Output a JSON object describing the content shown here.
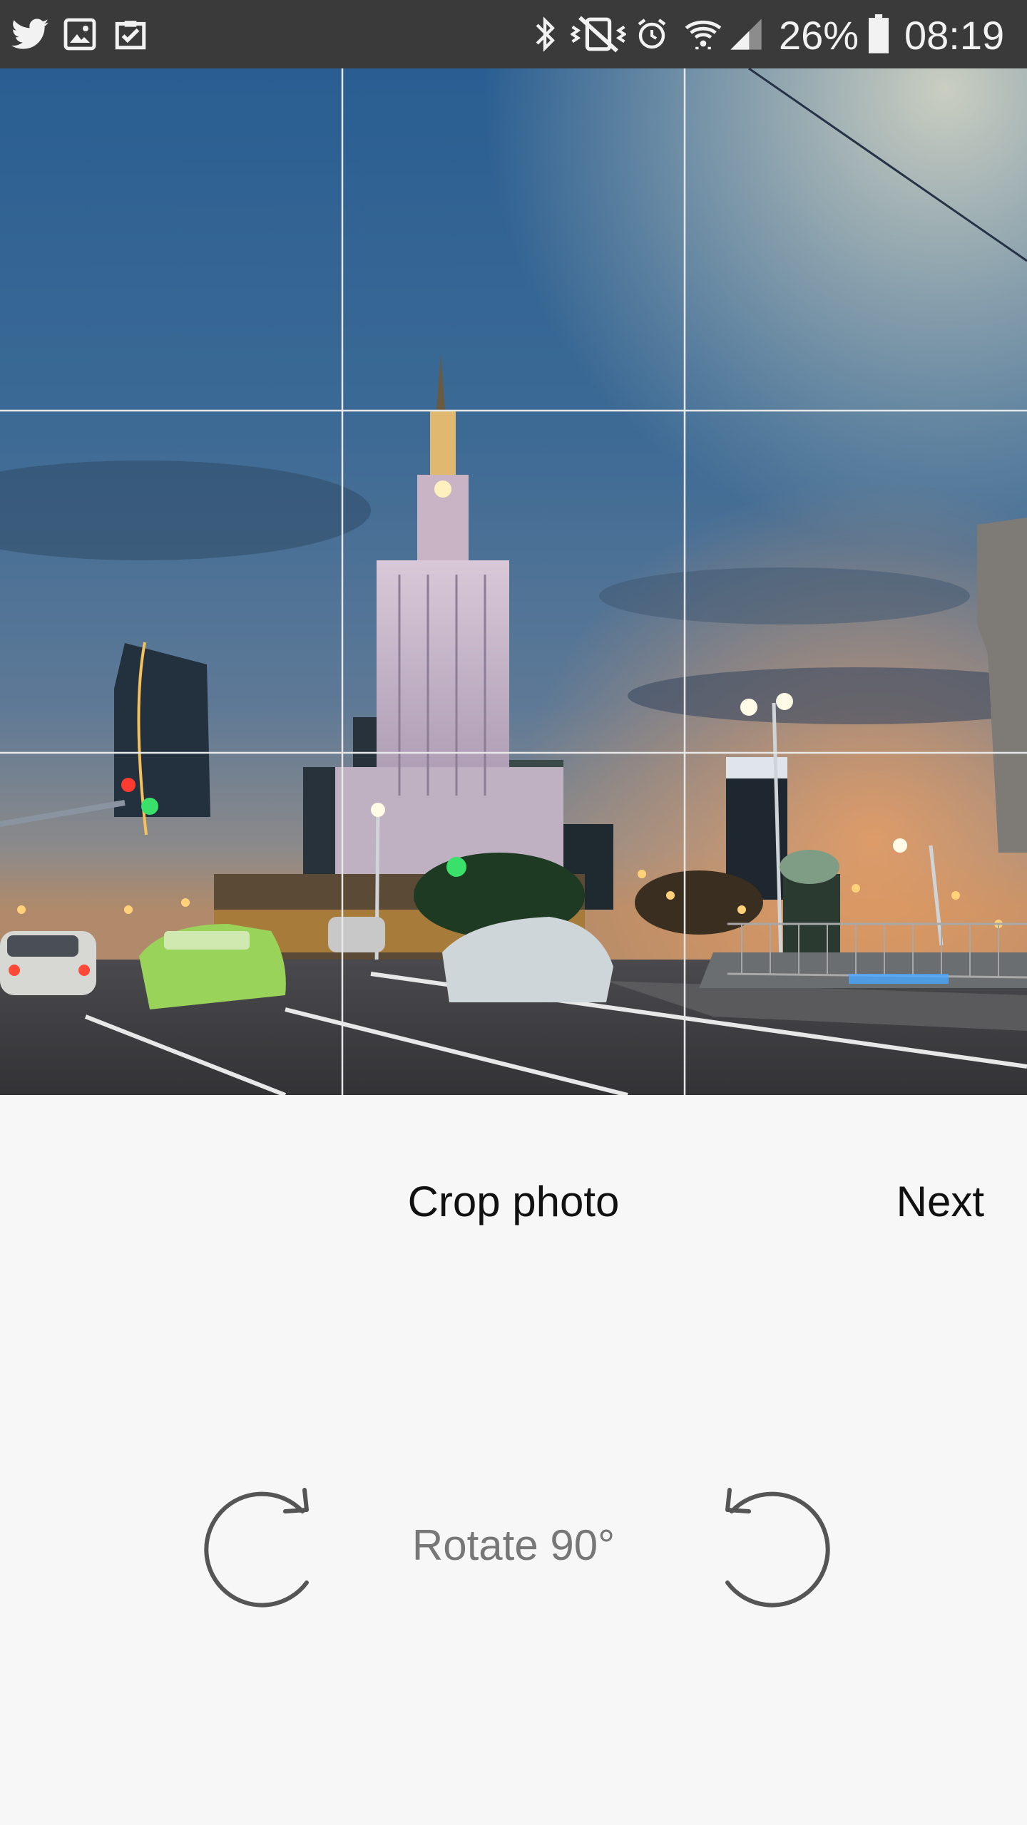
{
  "status_bar": {
    "battery": "26%",
    "time": "08:19",
    "left_icons": [
      "twitter-icon",
      "gallery-icon",
      "clipboard-check-icon"
    ],
    "right_icons": [
      "bluetooth-icon",
      "vibrate-mute-icon",
      "alarm-icon",
      "wifi-icon",
      "signal-icon",
      "battery-icon"
    ]
  },
  "crop": {
    "title": "Crop photo",
    "next_label": "Next",
    "rotate_label": "Rotate 90°"
  },
  "colors": {
    "status_bar_bg": "#3a3a3a",
    "panel_bg": "#f7f7f7",
    "grid_line": "#e8e8e8",
    "icon_gray": "#555555"
  }
}
